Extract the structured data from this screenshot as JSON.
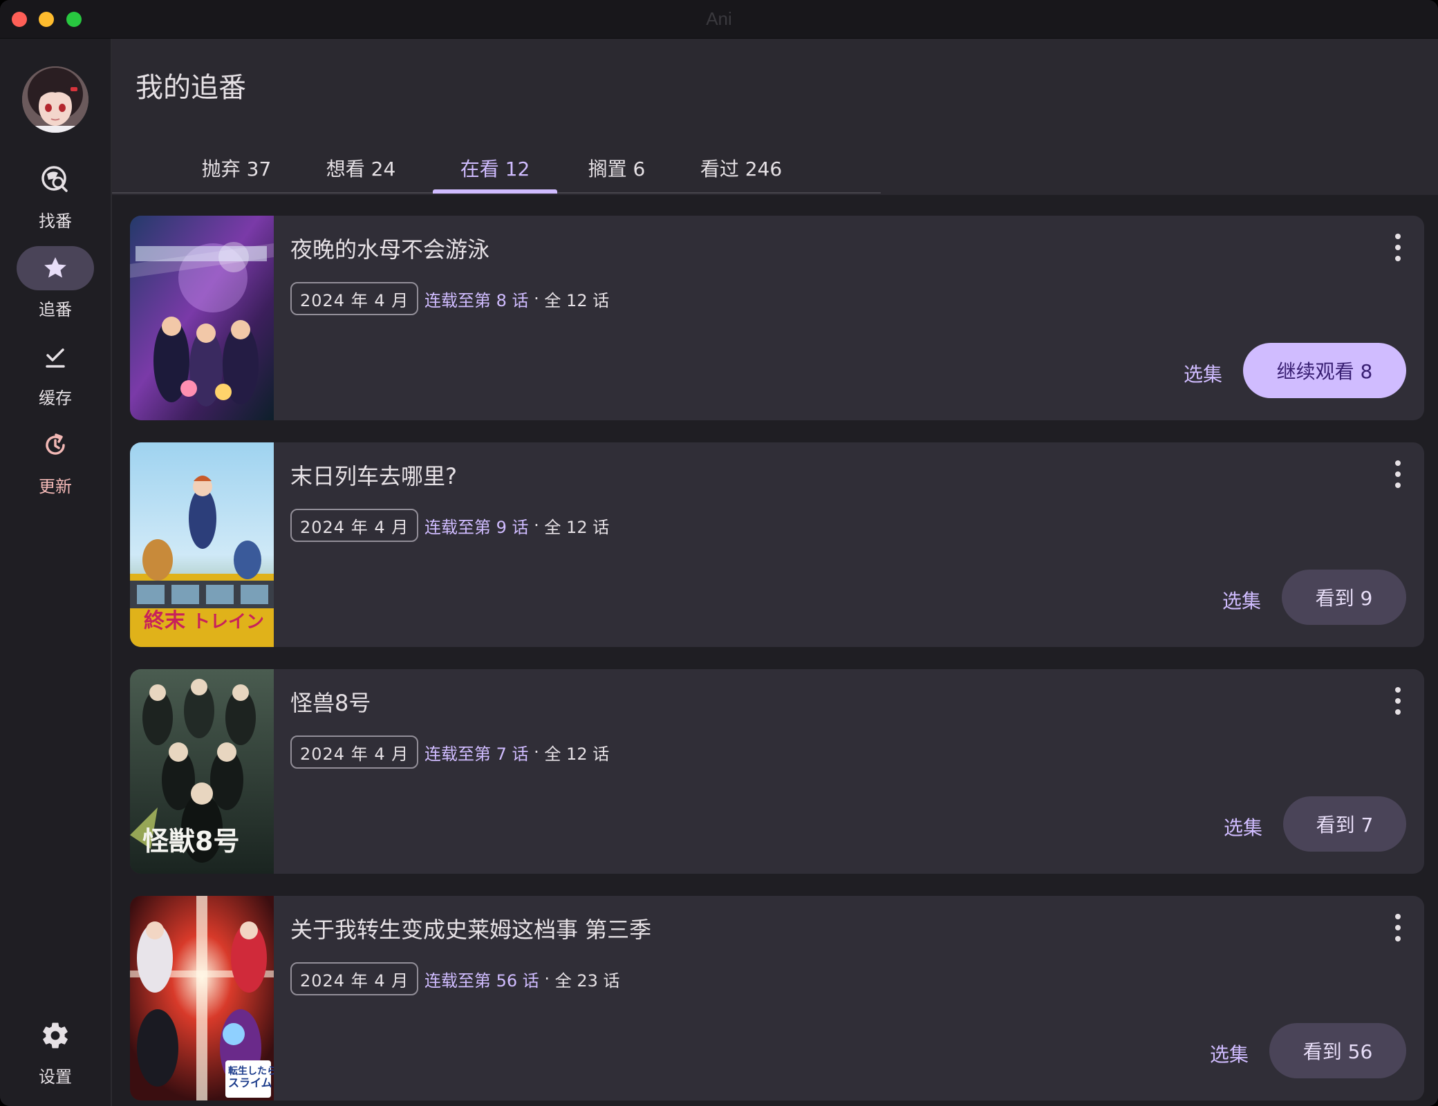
{
  "window": {
    "title": "Ani"
  },
  "sidebar": {
    "items": [
      {
        "label": "找番",
        "icon": "search-discover-icon"
      },
      {
        "label": "追番",
        "icon": "star-icon",
        "active": true
      },
      {
        "label": "缓存",
        "icon": "download-check-icon"
      },
      {
        "label": "更新",
        "icon": "update-icon"
      }
    ],
    "settings_label": "设置"
  },
  "header": {
    "title": "我的追番"
  },
  "tabs": [
    {
      "label": "抛弃 37"
    },
    {
      "label": "想看 24"
    },
    {
      "label": "在看 12",
      "active": true
    },
    {
      "label": "搁置 6"
    },
    {
      "label": "看过 246"
    }
  ],
  "subjects": [
    {
      "title": "夜晚的水母不会游泳",
      "date": "2024 年 4 月",
      "status": "连载至第 8 话",
      "sep": " · ",
      "total": "全 12 话",
      "select_label": "选集",
      "action_label": "继续观看 8",
      "action_style": "primary"
    },
    {
      "title": "末日列车去哪里?",
      "date": "2024 年 4 月",
      "status": "连载至第 9 话",
      "sep": " · ",
      "total": "全 12 话",
      "select_label": "选集",
      "action_label": "看到 9",
      "action_style": "secondary"
    },
    {
      "title": "怪兽8号",
      "date": "2024 年 4 月",
      "status": "连载至第 7 话",
      "sep": " · ",
      "total": "全 12 话",
      "select_label": "选集",
      "action_label": "看到 7",
      "action_style": "secondary"
    },
    {
      "title": "关于我转生变成史莱姆这档事 第三季",
      "date": "2024 年 4 月",
      "status": "连载至第 56 话",
      "sep": " · ",
      "total": "全 23 话",
      "select_label": "选集",
      "action_label": "看到 56",
      "action_style": "secondary"
    }
  ],
  "colors": {
    "accent": "#d0bcff",
    "on_accent": "#381e72",
    "secondary_container": "#4a4458",
    "card": "#302e37",
    "update_accent": "#f2b8b5"
  }
}
